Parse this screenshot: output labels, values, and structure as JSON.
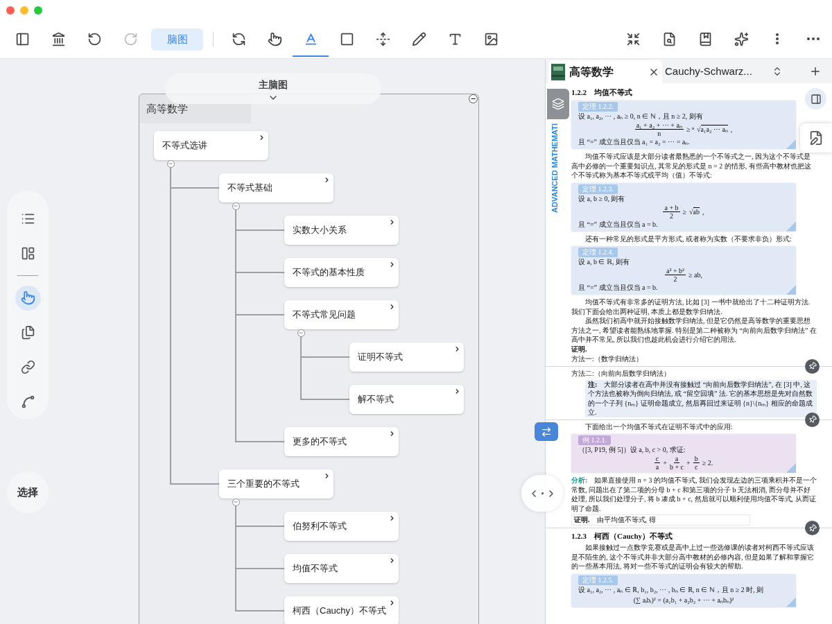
{
  "toolbar": {
    "left": [
      {
        "kind": "icon",
        "selected": false,
        "disabled": false
      },
      {
        "kind": "icon",
        "selected": false,
        "disabled": false
      },
      {
        "kind": "icon",
        "selected": false,
        "disabled": false
      },
      {
        "kind": "icon",
        "selected": false,
        "disabled": true
      },
      {
        "kind": "text",
        "label": "脑图",
        "selected": true,
        "disabled": false
      },
      {
        "kind": "divider"
      },
      {
        "kind": "icon",
        "selected": false,
        "disabled": false
      },
      {
        "kind": "icon",
        "selected": false,
        "disabled": false
      },
      {
        "kind": "icon",
        "selected": true,
        "disabled": false
      },
      {
        "kind": "icon",
        "selected": false,
        "disabled": false
      },
      {
        "kind": "icon",
        "selected": false,
        "disabled": false
      },
      {
        "kind": "icon",
        "selected": false,
        "disabled": false
      },
      {
        "kind": "icon",
        "selected": false,
        "disabled": false
      },
      {
        "kind": "icon",
        "selected": false,
        "disabled": false
      }
    ],
    "right": [
      {
        "selected": false,
        "disabled": false
      },
      {
        "selected": false,
        "disabled": false
      },
      {
        "selected": false,
        "disabled": false
      },
      {
        "selected": false,
        "disabled": false
      },
      {
        "selected": false,
        "disabled": false
      },
      {
        "selected": false,
        "disabled": false
      }
    ]
  },
  "left_rail": {
    "tools": [
      {
        "kind": "tool",
        "selected": false
      },
      {
        "kind": "tool",
        "selected": false
      },
      {
        "kind": "divider"
      },
      {
        "kind": "tool",
        "selected": true
      },
      {
        "kind": "tool",
        "selected": false
      },
      {
        "kind": "tool",
        "selected": false
      },
      {
        "kind": "tool",
        "selected": false
      }
    ],
    "select_button": "选择"
  },
  "mind_map": {
    "title": "主脑图",
    "frame_label": "高等数学",
    "frame_expanded": true,
    "nodes": [
      {
        "label": "不等式选讲",
        "expanded": true,
        "children": [
          {
            "label": "不等式基础",
            "expanded": true,
            "children": [
              {
                "label": "实数大小关系"
              },
              {
                "label": "不等式的基本性质"
              },
              {
                "label": "不等式常见问题",
                "expanded": true,
                "children": [
                  {
                    "label": "证明不等式"
                  },
                  {
                    "label": "解不等式"
                  }
                ]
              },
              {
                "label": "更多的不等式"
              }
            ]
          },
          {
            "label": "三个重要的不等式",
            "expanded": true,
            "children": [
              {
                "label": "伯努利不等式"
              },
              {
                "label": "均值不等式"
              },
              {
                "label": "柯西（Cauchy）不等式"
              }
            ]
          }
        ]
      }
    ]
  },
  "reader": {
    "tabs": [
      {
        "label": "高等数学",
        "selected": true,
        "closable": true
      },
      {
        "label": "Cauchy-Schwarz...",
        "selected": false,
        "closable": false
      }
    ],
    "spine_text": "ADVANCED MATHEMATI",
    "blocks": [
      {
        "kind": "heading",
        "text": "1.2.2　均值不等式"
      },
      {
        "kind": "theorem",
        "label": "定理 1.2.2.",
        "lines": [
          {
            "kind": "text",
            "text": "设 a₁, a₂, ⋯ , aₙ ≥ 0, n ∈ ℕ，且 n ≥ 2, 则有"
          },
          {
            "kind": "formula",
            "parts": [
              {
                "kind": "frac",
                "num": "a₁ + a₂ + ⋯ + aₙ",
                "den": "n"
              },
              {
                "kind": "text",
                "text": "≥ ⁿ"
              },
              {
                "kind": "root",
                "sign": "√",
                "radicand": "a₁a₂ ⋯ aₙ"
              },
              {
                "kind": "text",
                "text": ","
              }
            ]
          },
          {
            "kind": "text",
            "text": "且 “=” 成立当且仅当 a₁ = a₂ = ⋯ = aₙ."
          }
        ]
      },
      {
        "kind": "paragraph",
        "text": "均值不等式应该是大部分读者最熟悉的一个不等式之一, 因为这个不等式是高中必修的一个重要知识点, 其常见的形式是 n = 2 的情形, 有些高中教材也把这个不等式称为基本不等式或平均（值）不等式:"
      },
      {
        "kind": "theorem",
        "label": "定理 1.2.3.",
        "lines": [
          {
            "kind": "text",
            "text": "设 a, b ≥ 0, 则有"
          },
          {
            "kind": "formula",
            "parts": [
              {
                "kind": "frac",
                "num": "a + b",
                "den": "2"
              },
              {
                "kind": "text",
                "text": "≥"
              },
              {
                "kind": "root",
                "sign": "√",
                "radicand": "ab"
              },
              {
                "kind": "text",
                "text": ","
              }
            ]
          },
          {
            "kind": "text",
            "text": "且 “=” 成立当且仅当 a = b."
          }
        ]
      },
      {
        "kind": "paragraph",
        "text": "还有一种常见的形式是平方形式, 或者称为实数（不要求非负）形式:"
      },
      {
        "kind": "theorem",
        "label": "定理 1.2.4.",
        "lines": [
          {
            "kind": "text",
            "text": "设 a, b ∈ ℝ, 则有"
          },
          {
            "kind": "formula",
            "parts": [
              {
                "kind": "frac",
                "num": "a² + b²",
                "den": "2"
              },
              {
                "kind": "text",
                "text": "≥ ab,"
              }
            ]
          },
          {
            "kind": "text",
            "text": "且 “=” 成立当且仅当 a = b."
          }
        ]
      },
      {
        "kind": "paragraph",
        "text": "均值不等式有非常多的证明方法, 比如 [3] 一书中就给出了十二种证明方法. 我们下面会给出两种证明, 本质上都是数学归纳法."
      },
      {
        "kind": "paragraph",
        "text": "虽然我们初高中就开始接触数学归纳法, 但是它仍然是高等数学的重要思想方法之一, 希望读者能熟练地掌握. 特别是第二种被称为 “向前向后数学归纳法” 在高中并不常见, 所以我们也趁此机会进行介绍它的用法."
      },
      {
        "kind": "proof",
        "label": "证明.",
        "framed": false
      },
      {
        "kind": "line",
        "text": "方法一:（数学归纳法）"
      },
      {
        "kind": "break"
      },
      {
        "kind": "line",
        "text": "方法二:（向前向后数学归纳法）"
      },
      {
        "kind": "note",
        "label": "注:",
        "text": "大部分读者在高中并没有接触过 “向前向后数学归纳法”, 在 [3] 中, 这个方法也被称为倒向归纳法, 或 “留空回填” 法. 它的基本思想是先对自然数的一个子列 {nₘ} 证明命题成立, 然后再回过来证明 {n}\\{nₘ} 相应的命题成立."
      },
      {
        "kind": "break"
      },
      {
        "kind": "paragraph",
        "text": "下面给出一个均值不等式在证明不等式中的应用:"
      },
      {
        "kind": "example",
        "label": "例 1.2.1.",
        "lines": [
          {
            "kind": "text",
            "text": "（[3, P19, 例 5]）设 a, b, c > 0, 求证:"
          },
          {
            "kind": "formula",
            "parts": [
              {
                "kind": "frac",
                "num": "c",
                "den": "a"
              },
              {
                "kind": "text",
                "text": "+"
              },
              {
                "kind": "frac",
                "num": "a",
                "den": "b + c"
              },
              {
                "kind": "text",
                "text": "+"
              },
              {
                "kind": "frac",
                "num": "b",
                "den": "c"
              },
              {
                "kind": "text",
                "text": "≥ 2."
              }
            ]
          }
        ]
      },
      {
        "kind": "analysis",
        "label": "分析:",
        "text": "如果直接使用 n = 3 的均值不等式, 我们会发现左边的三项乘积并不是一个常数, 问题出在了第二项的分母 b + c 和第三项的分子 b 无法相消, 而分母并不好处理, 所以我们处理分子, 将 b 凑成 b + c, 然后就可以顺利使用均值不等式, 从而证明了命题."
      },
      {
        "kind": "proof",
        "label": "证明.",
        "text": "由平均值不等式, 得",
        "framed": true
      },
      {
        "kind": "break"
      },
      {
        "kind": "heading",
        "text": "1.2.3　柯西（Cauchy）不等式"
      },
      {
        "kind": "paragraph",
        "text": "如果接触过一点数学竞赛或是高中上过一些选修课的读者对柯西不等式应该是不陌生的, 这个不等式并非大部分高中教材的必修内容, 但是如果了解和掌握它的一些基本用法, 将对一些不等式的证明会有较大的帮助."
      },
      {
        "kind": "theorem",
        "label": "定理 1.2.5.",
        "lines": [
          {
            "kind": "text",
            "text": "设 a₁, a₂, ⋯ , aₙ ∈ ℝ, b₁, b₂, ⋯ , bₙ ∈ ℝ, n ∈ ℕ，且 n ≥ 2 时, 则"
          },
          {
            "kind": "formula",
            "parts": [
              {
                "kind": "text",
                "text": "(∑ aᵢbᵢ)² = (a₁b₁ + a₂b₂ + ⋯ + aₙbₙ)²"
              }
            ]
          }
        ]
      }
    ]
  }
}
